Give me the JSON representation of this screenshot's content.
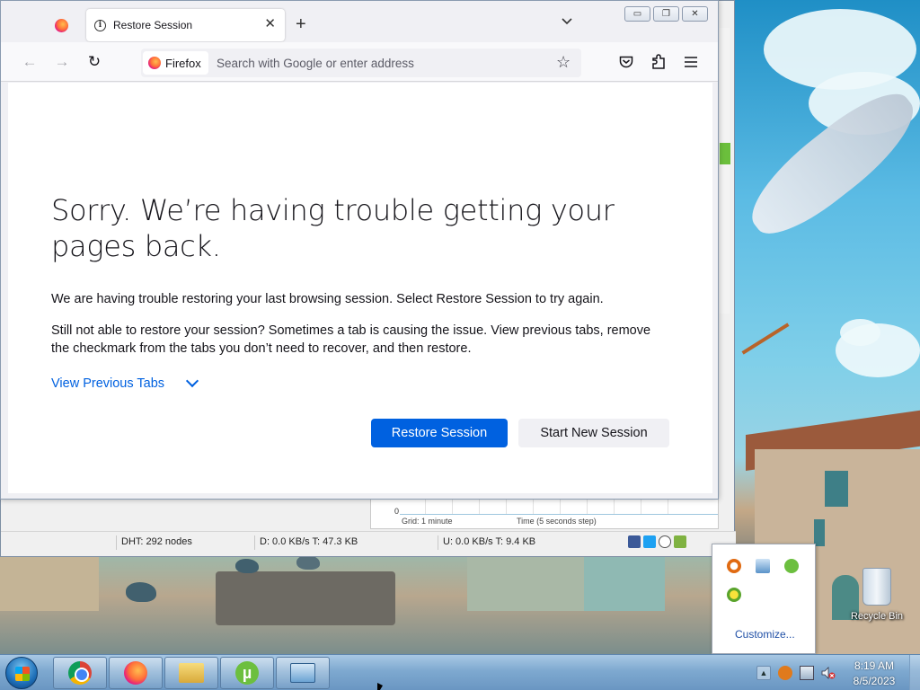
{
  "browser": {
    "active_tab_title": "Restore Session",
    "identity_label": "Firefox",
    "url_placeholder": "Search with Google or enter address",
    "window_buttons": {
      "minimize": "▭",
      "restore": "❐",
      "close": "✕"
    }
  },
  "error_page": {
    "title": "Sorry. We’re having trouble getting your pages back.",
    "paragraph1": "We are having trouble restoring your last browsing session. Select Restore Session to try again.",
    "paragraph2": "Still not able to restore your session? Sometimes a tab is causing the issue. View previous tabs, remove the checkmark from the tabs you don’t need to recover, and then restore.",
    "view_previous_tabs": "View Previous Tabs",
    "restore_button": "Restore Session",
    "new_session_button": "Start New Session"
  },
  "utorrent": {
    "graph_zero": "0",
    "graph_grid": "Grid: 1 minute",
    "graph_time": "Time (5 seconds step)",
    "status_dht": "DHT: 292 nodes",
    "status_download": "D: 0.0 KB/s T: 47.3 KB",
    "status_upload": "U: 0.0 KB/s T: 9.4 KB"
  },
  "tray_popup": {
    "customize_link": "Customize..."
  },
  "desktop": {
    "recycle_bin_label": "Recycle Bin"
  },
  "taskbar": {
    "clock_time": "8:19 AM",
    "clock_date": "8/5/2023"
  },
  "colors": {
    "accent_blue": "#0061e0",
    "utorrent_green": "#6bbf3c"
  }
}
